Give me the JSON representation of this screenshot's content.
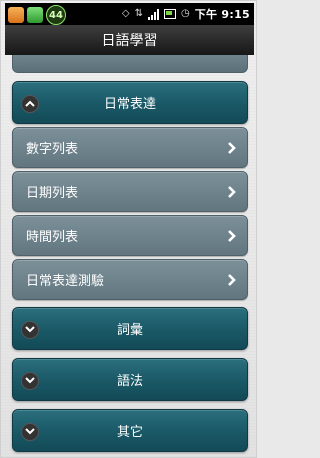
{
  "status_bar": {
    "notification_count": "44",
    "time": "下午 9:15"
  },
  "title_bar": {
    "title": "日語學習"
  },
  "sections": [
    {
      "label": "日常表達",
      "expanded": true
    },
    {
      "label": "詞彙",
      "expanded": false
    },
    {
      "label": "語法",
      "expanded": false
    },
    {
      "label": "其它",
      "expanded": false
    }
  ],
  "sub_items": [
    {
      "label": "數字列表"
    },
    {
      "label": "日期列表"
    },
    {
      "label": "時間列表"
    },
    {
      "label": "日常表達測驗"
    }
  ],
  "colors": {
    "section_bg": "#1a5866",
    "subitem_bg": "#6b7f89",
    "titlebar_bg": "#222222"
  },
  "icons": {
    "expanded": "chevron-up-icon",
    "collapsed": "chevron-down-icon",
    "subitem": "chevron-right-icon"
  }
}
